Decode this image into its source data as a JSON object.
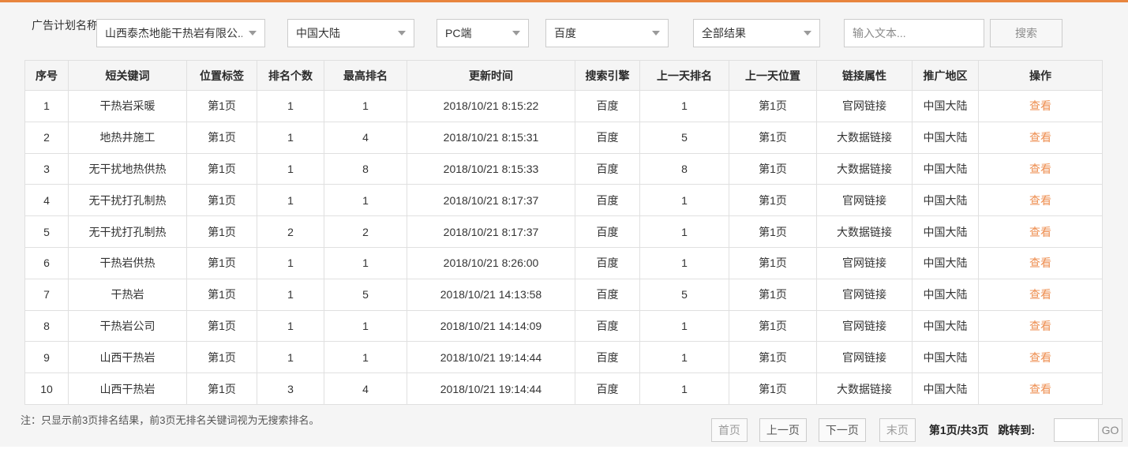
{
  "accent": {
    "top_border": "#e8853e",
    "link_color": "#ee8e50"
  },
  "filter_bar": {
    "label": "广告计划名称:",
    "dropdowns": [
      {
        "value": "山西泰杰地能干热岩有限公..."
      },
      {
        "value": "中国大陆"
      },
      {
        "value": "PC端"
      },
      {
        "value": "百度"
      },
      {
        "value": "全部结果"
      }
    ],
    "search_input_placeholder": "输入文本...",
    "search_button_label": "搜索"
  },
  "table": {
    "columns": [
      "序号",
      "短关键词",
      "位置标签",
      "排名个数",
      "最高排名",
      "更新时间",
      "搜索引擎",
      "上一天排名",
      "上一天位置",
      "链接属性",
      "推广地区",
      "操作"
    ],
    "rows": [
      {
        "index": "1",
        "keyword": "干热岩采暖",
        "position_tag": "第1页",
        "rank_count": "1",
        "best_rank": "1",
        "updated": "2018/10/21 8:15:22",
        "engine": "百度",
        "prev_rank": "1",
        "prev_position": "第1页",
        "link_type": "官网链接",
        "region": "中国大陆",
        "action": "查看"
      },
      {
        "index": "2",
        "keyword": "地热井施工",
        "position_tag": "第1页",
        "rank_count": "1",
        "best_rank": "4",
        "updated": "2018/10/21 8:15:31",
        "engine": "百度",
        "prev_rank": "5",
        "prev_position": "第1页",
        "link_type": "大数据链接",
        "region": "中国大陆",
        "action": "查看"
      },
      {
        "index": "3",
        "keyword": "无干扰地热供热",
        "position_tag": "第1页",
        "rank_count": "1",
        "best_rank": "8",
        "updated": "2018/10/21 8:15:33",
        "engine": "百度",
        "prev_rank": "8",
        "prev_position": "第1页",
        "link_type": "大数据链接",
        "region": "中国大陆",
        "action": "查看"
      },
      {
        "index": "4",
        "keyword": "无干扰打孔制热",
        "position_tag": "第1页",
        "rank_count": "1",
        "best_rank": "1",
        "updated": "2018/10/21 8:17:37",
        "engine": "百度",
        "prev_rank": "1",
        "prev_position": "第1页",
        "link_type": "官网链接",
        "region": "中国大陆",
        "action": "查看"
      },
      {
        "index": "5",
        "keyword": "无干扰打孔制热",
        "position_tag": "第1页",
        "rank_count": "2",
        "best_rank": "2",
        "updated": "2018/10/21 8:17:37",
        "engine": "百度",
        "prev_rank": "1",
        "prev_position": "第1页",
        "link_type": "大数据链接",
        "region": "中国大陆",
        "action": "查看"
      },
      {
        "index": "6",
        "keyword": "干热岩供热",
        "position_tag": "第1页",
        "rank_count": "1",
        "best_rank": "1",
        "updated": "2018/10/21 8:26:00",
        "engine": "百度",
        "prev_rank": "1",
        "prev_position": "第1页",
        "link_type": "官网链接",
        "region": "中国大陆",
        "action": "查看"
      },
      {
        "index": "7",
        "keyword": "干热岩",
        "position_tag": "第1页",
        "rank_count": "1",
        "best_rank": "5",
        "updated": "2018/10/21 14:13:58",
        "engine": "百度",
        "prev_rank": "5",
        "prev_position": "第1页",
        "link_type": "官网链接",
        "region": "中国大陆",
        "action": "查看"
      },
      {
        "index": "8",
        "keyword": "干热岩公司",
        "position_tag": "第1页",
        "rank_count": "1",
        "best_rank": "1",
        "updated": "2018/10/21 14:14:09",
        "engine": "百度",
        "prev_rank": "1",
        "prev_position": "第1页",
        "link_type": "官网链接",
        "region": "中国大陆",
        "action": "查看"
      },
      {
        "index": "9",
        "keyword": "山西干热岩",
        "position_tag": "第1页",
        "rank_count": "1",
        "best_rank": "1",
        "updated": "2018/10/21 19:14:44",
        "engine": "百度",
        "prev_rank": "1",
        "prev_position": "第1页",
        "link_type": "官网链接",
        "region": "中国大陆",
        "action": "查看"
      },
      {
        "index": "10",
        "keyword": "山西干热岩",
        "position_tag": "第1页",
        "rank_count": "3",
        "best_rank": "4",
        "updated": "2018/10/21 19:14:44",
        "engine": "百度",
        "prev_rank": "1",
        "prev_position": "第1页",
        "link_type": "大数据链接",
        "region": "中国大陆",
        "action": "查看"
      }
    ]
  },
  "footer": {
    "note": "注：只显示前3页排名结果，前3页无排名关键词视为无搜索排名。",
    "pagination": {
      "first_label": "首页",
      "prev_label": "上一页",
      "next_label": "下一页",
      "last_label": "末页",
      "page_info": "第1页/共3页",
      "jump_label": "跳转到:",
      "jump_value": "",
      "go_label": "GO"
    }
  }
}
